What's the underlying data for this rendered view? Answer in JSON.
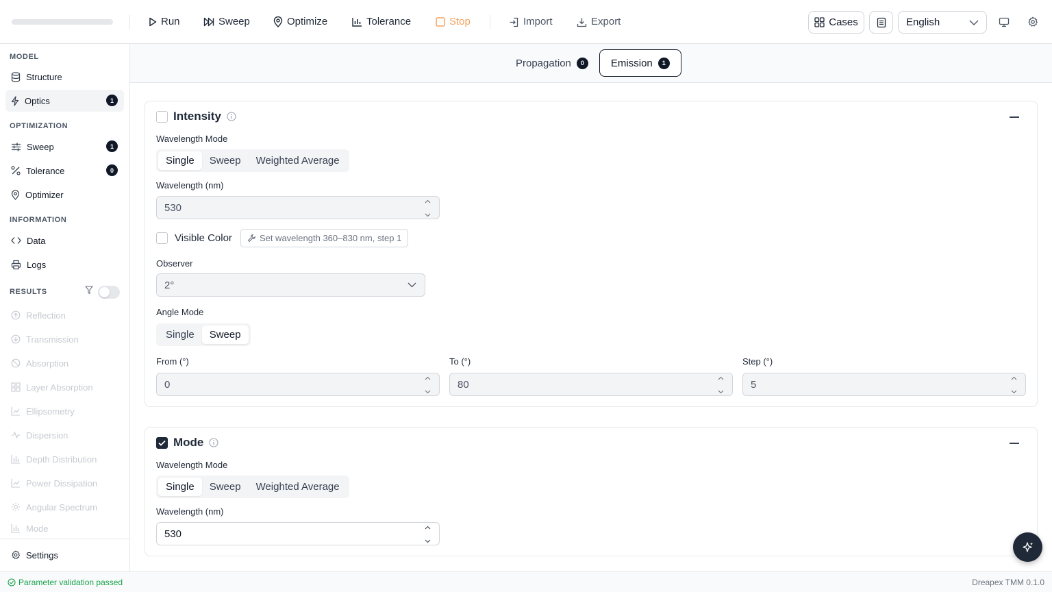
{
  "toolbar": {
    "run": "Run",
    "sweep": "Sweep",
    "optimize": "Optimize",
    "tolerance": "Tolerance",
    "stop": "Stop",
    "import": "Import",
    "export": "Export",
    "cases": "Cases",
    "language": "English",
    "accent_stop_color": "#f6a25d"
  },
  "sidebar": {
    "model_title": "MODEL",
    "structure": "Structure",
    "optics": "Optics",
    "optics_count": "1",
    "optimization_title": "OPTIMIZATION",
    "sweep": "Sweep",
    "sweep_count": "1",
    "tolerance": "Tolerance",
    "tolerance_count": "0",
    "optimizer": "Optimizer",
    "information_title": "INFORMATION",
    "data": "Data",
    "logs": "Logs",
    "results_title": "RESULTS",
    "results": [
      "Reflection",
      "Transmission",
      "Absorption",
      "Layer Absorption",
      "Ellipsometry",
      "Dispersion",
      "Depth Distribution",
      "Power Dissipation",
      "Angular Spectrum",
      "Mode"
    ],
    "settings": "Settings"
  },
  "tabs": {
    "propagation": "Propagation",
    "propagation_count": "0",
    "emission": "Emission",
    "emission_count": "1"
  },
  "intensity": {
    "title": "Intensity",
    "wavelength_mode_label": "Wavelength Mode",
    "modes": [
      "Single",
      "Sweep",
      "Weighted Average"
    ],
    "wavelength_label": "Wavelength (nm)",
    "wavelength_value": "530",
    "visible_color_label": "Visible Color",
    "visible_hint": "Set wavelength 360–830 nm, step 1",
    "observer_label": "Observer",
    "observer_value": "2°",
    "angle_mode_label": "Angle Mode",
    "angle_modes": [
      "Single",
      "Sweep"
    ],
    "from_label": "From (°)",
    "from_value": "0",
    "to_label": "To (°)",
    "to_value": "80",
    "step_label": "Step (°)",
    "step_value": "5"
  },
  "mode": {
    "title": "Mode",
    "wavelength_mode_label": "Wavelength Mode",
    "modes": [
      "Single",
      "Sweep",
      "Weighted Average"
    ],
    "wavelength_label": "Wavelength (nm)",
    "wavelength_value": "530"
  },
  "status": {
    "message": "Parameter validation passed",
    "version": "Dreapex TMM 0.1.0",
    "ok_color": "#16a34a"
  }
}
